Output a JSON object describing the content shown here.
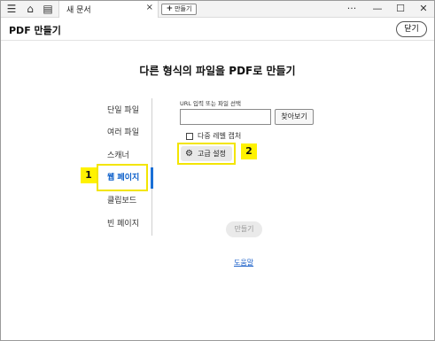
{
  "titlebar": {
    "menu_icon": "☰",
    "home_icon": "⌂",
    "files_icon": "▤",
    "tab_label": "새 문서",
    "tab_close": "×",
    "new_tab_plus": "+",
    "new_tab_label": "만들기",
    "more_icon": "···",
    "minimize_icon": "—",
    "maximize_icon": "☐",
    "close_icon": "✕"
  },
  "header": {
    "title": "PDF 만들기",
    "close_label": "닫기"
  },
  "main": {
    "title": "다른 형식의 파일을 PDF로 만들기"
  },
  "sidebar": {
    "items": [
      {
        "label": "단일 파일"
      },
      {
        "label": "여러 파일"
      },
      {
        "label": "스캐너"
      },
      {
        "label": "웹 페이지"
      },
      {
        "label": "클립보드"
      },
      {
        "label": "빈 페이지"
      }
    ],
    "active_index": 3
  },
  "form": {
    "url_label": "URL 입력 또는 파일 선택",
    "url_value": "",
    "browse_label": "찾아보기",
    "multilevel_label": "다중 레벨 캡처",
    "multilevel_checked": false,
    "advanced_label": "고급 설정",
    "gear_icon": "⚙",
    "create_label": "만들기",
    "help_label": "도움말"
  },
  "annotations": {
    "badge1": "1",
    "badge2": "2"
  },
  "colors": {
    "accent": "#1a6fd6",
    "highlight": "#f3e500",
    "badge": "#fff200",
    "link": "#1a5fc8"
  }
}
